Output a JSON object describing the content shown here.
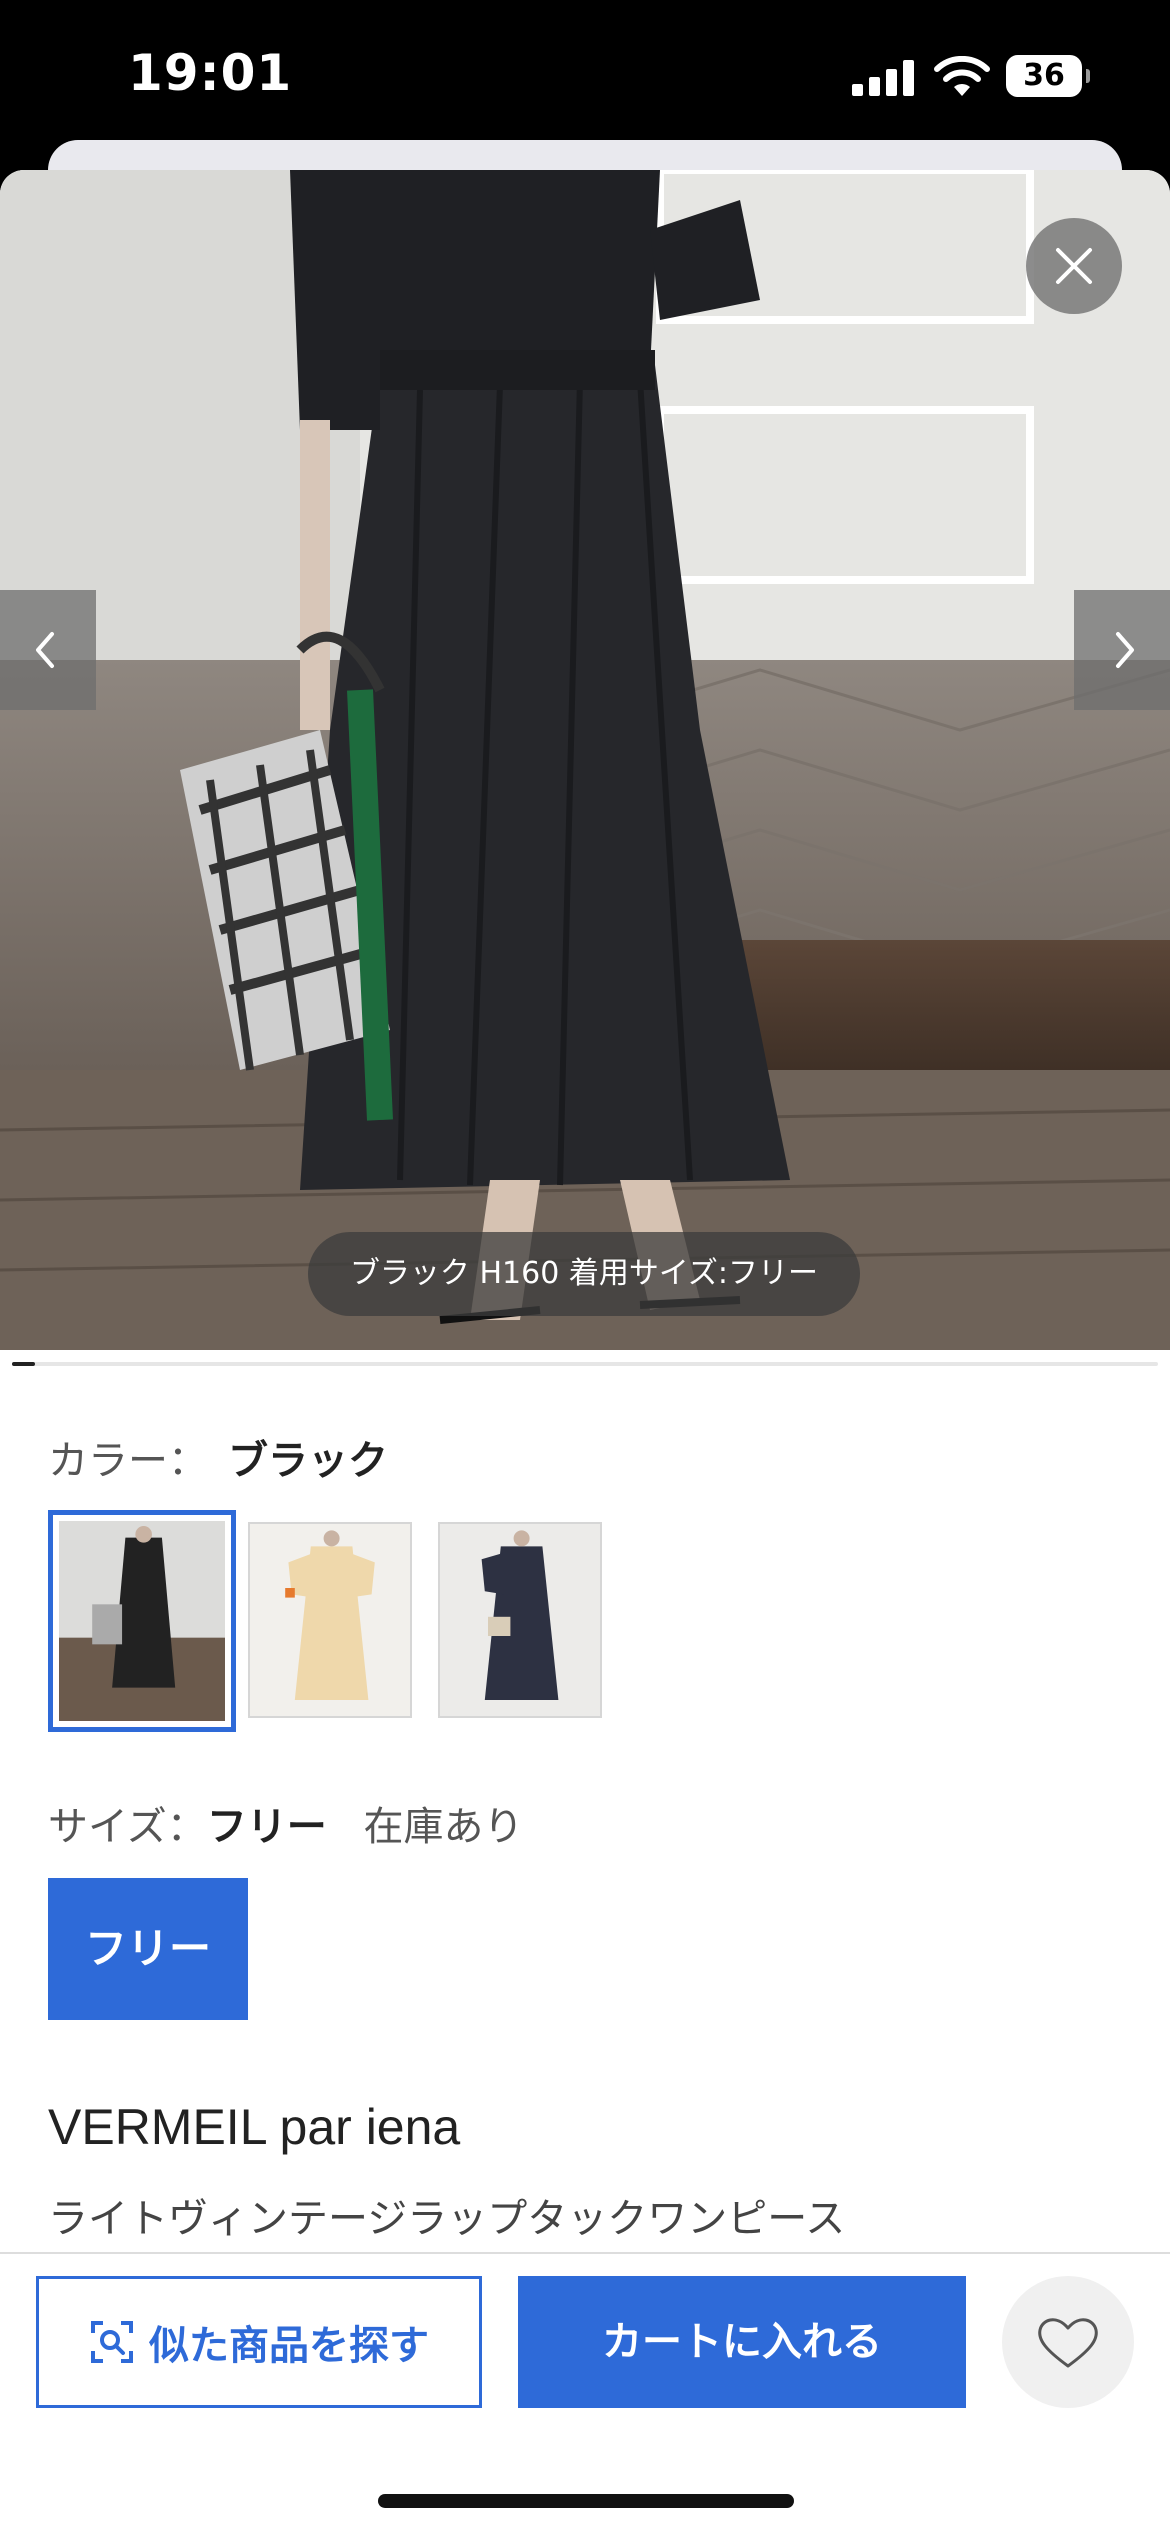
{
  "status_bar": {
    "time": "19:01",
    "battery": "36"
  },
  "gallery": {
    "caption": "ブラック H160 着用サイズ:フリー",
    "progress": 0.02
  },
  "color": {
    "label": "カラー：",
    "value": "ブラック"
  },
  "swatches": [
    {
      "name": "ブラック",
      "selected": true
    },
    {
      "name": "ベージュ",
      "selected": false
    },
    {
      "name": "ネイビー",
      "selected": false
    }
  ],
  "size": {
    "label": "サイズ：",
    "value": "フリー",
    "stock": "在庫あり",
    "option": "フリー"
  },
  "product": {
    "brand": "VERMEIL par iena",
    "name": "ライトヴィンテージラップタックワンピース"
  },
  "actions": {
    "find_similar": "似た商品を探す",
    "add_to_cart": "カートに入れる"
  },
  "colors": {
    "accent": "#2e6ad8"
  }
}
